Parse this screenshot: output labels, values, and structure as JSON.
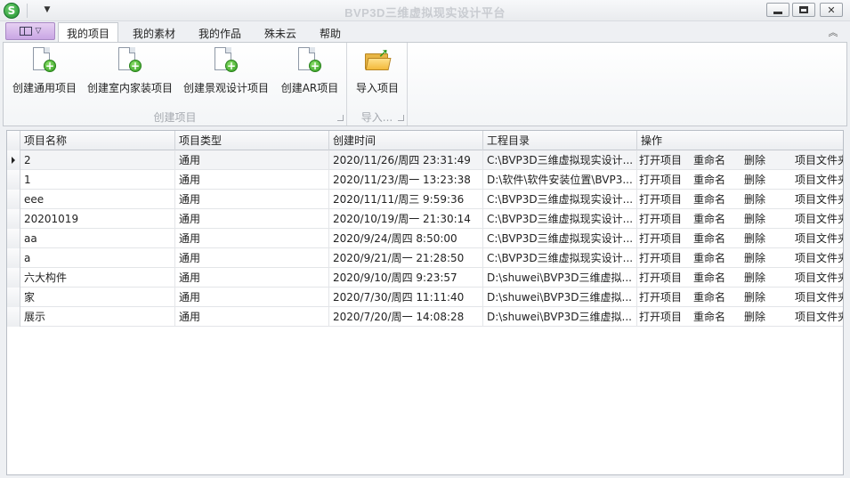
{
  "window": {
    "title": "BVP3D三维虚拟现实设计平台",
    "logo_letter": "S",
    "qat_dropdown_icon": "▼",
    "minimize_icon": "minimize-icon",
    "maximize_icon": "maximize-icon",
    "close_glyph": "✕"
  },
  "ribbon": {
    "app_menu_arrow": "▽",
    "tabs": [
      {
        "label": "我的项目",
        "active": true
      },
      {
        "label": "我的素材",
        "active": false
      },
      {
        "label": "我的作品",
        "active": false
      },
      {
        "label": "殊未云",
        "active": false
      },
      {
        "label": "帮助",
        "active": false
      }
    ],
    "collapse_glyph": "︽",
    "groups": {
      "create": {
        "label": "创建项目",
        "buttons": [
          {
            "label": "创建通用项目",
            "icon": "new-document-icon"
          },
          {
            "label": "创建室内家装项目",
            "icon": "new-document-icon"
          },
          {
            "label": "创建景观设计项目",
            "icon": "new-document-icon"
          },
          {
            "label": "创建AR项目",
            "icon": "new-document-icon"
          }
        ]
      },
      "import": {
        "label": "导入...",
        "buttons": [
          {
            "label": "导入项目",
            "icon": "open-folder-icon"
          }
        ]
      }
    }
  },
  "grid": {
    "columns": [
      "项目名称",
      "项目类型",
      "创建时间",
      "工程目录",
      "操作"
    ],
    "actions": [
      "打开项目",
      "重命名",
      "删除",
      "项目文件夹"
    ],
    "rows": [
      {
        "name": "2",
        "type": "通用",
        "time": "2020/11/26/周四 23:31:49",
        "dir": "C:\\BVP3D三维虚拟现实设计..."
      },
      {
        "name": "1",
        "type": "通用",
        "time": "2020/11/23/周一 13:23:38",
        "dir": "D:\\软件\\软件安装位置\\BVP3..."
      },
      {
        "name": "eee",
        "type": "通用",
        "time": "2020/11/11/周三 9:59:36",
        "dir": "C:\\BVP3D三维虚拟现实设计..."
      },
      {
        "name": "20201019",
        "type": "通用",
        "time": "2020/10/19/周一 21:30:14",
        "dir": "C:\\BVP3D三维虚拟现实设计..."
      },
      {
        "name": "aa",
        "type": "通用",
        "time": "2020/9/24/周四 8:50:00",
        "dir": "C:\\BVP3D三维虚拟现实设计..."
      },
      {
        "name": "a",
        "type": "通用",
        "time": "2020/9/21/周一 21:28:50",
        "dir": "C:\\BVP3D三维虚拟现实设计..."
      },
      {
        "name": "六大构件",
        "type": "通用",
        "time": "2020/9/10/周四 9:23:57",
        "dir": "D:\\shuwei\\BVP3D三维虚拟..."
      },
      {
        "name": "家",
        "type": "通用",
        "time": "2020/7/30/周四 11:11:40",
        "dir": "D:\\shuwei\\BVP3D三维虚拟..."
      },
      {
        "name": "展示",
        "type": "通用",
        "time": "2020/7/20/周一 14:08:28",
        "dir": "D:\\shuwei\\BVP3D三维虚拟..."
      }
    ],
    "current_row": 0
  }
}
